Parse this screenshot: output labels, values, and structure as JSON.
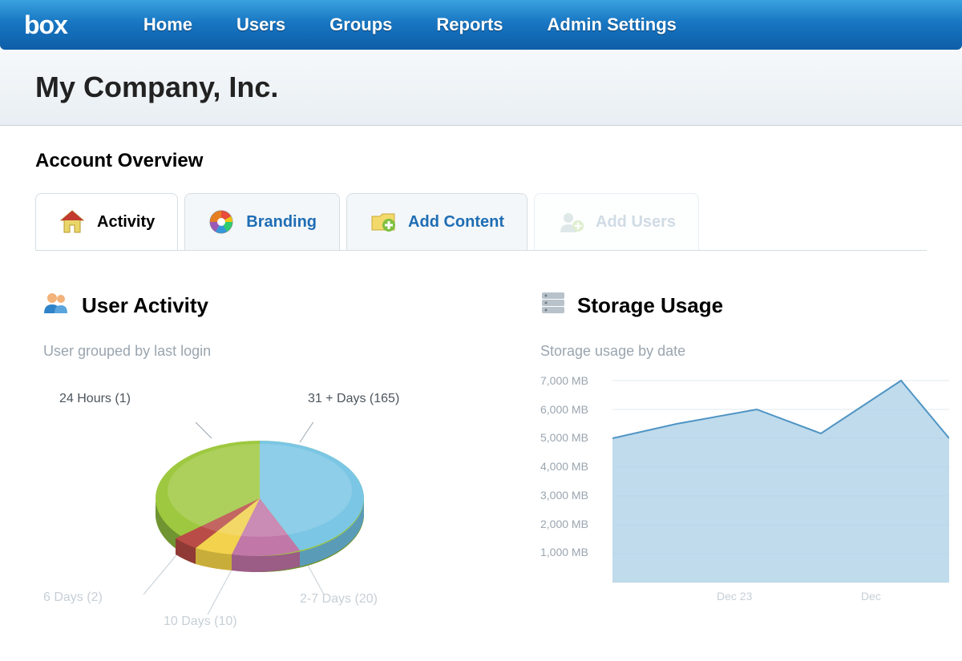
{
  "brand": "box",
  "nav": {
    "home": "Home",
    "users": "Users",
    "groups": "Groups",
    "reports": "Reports",
    "admin": "Admin Settings"
  },
  "header": {
    "company": "My Company, Inc."
  },
  "section": {
    "overview": "Account Overview"
  },
  "tabs": {
    "activity": "Activity",
    "branding": "Branding",
    "add_content": "Add Content",
    "add_users": "Add Users"
  },
  "user_activity": {
    "title": "User Activity",
    "subtitle": "User grouped by last login",
    "labels": {
      "l24h": "24 Hours (1)",
      "l31plus": "31 + Days (165)",
      "l6d": "6 Days (2)",
      "l10d": "10 Days (10)",
      "l2_7d": "2-7 Days (20)"
    }
  },
  "storage": {
    "title": "Storage Usage",
    "subtitle": "Storage usage by date",
    "yticks": [
      "7,000 MB",
      "6,000 MB",
      "5,000 MB",
      "4,000 MB",
      "3,000 MB",
      "2,000 MB",
      "1,000 MB"
    ],
    "xticks": [
      "Dec 23",
      "Dec"
    ]
  },
  "chart_data": [
    {
      "type": "pie",
      "title": "User grouped by last login",
      "categories": [
        "24 Hours",
        "31 + Days",
        "2-7 Days",
        "10 Days",
        "6 Days"
      ],
      "values": [
        1,
        165,
        20,
        10,
        2
      ],
      "colors": [
        "#9ec83f",
        "#7bc6e4",
        "#c177a7",
        "#f3d24d",
        "#b94c46"
      ]
    },
    {
      "type": "area",
      "title": "Storage usage by date",
      "ylabel": "MB",
      "ylim": [
        0,
        7000
      ],
      "x": [
        "Dec 23",
        "Dec"
      ],
      "series": [
        {
          "name": "Storage",
          "values": [
            5000,
            5500,
            6000,
            5200,
            7000,
            5000
          ]
        }
      ]
    }
  ]
}
